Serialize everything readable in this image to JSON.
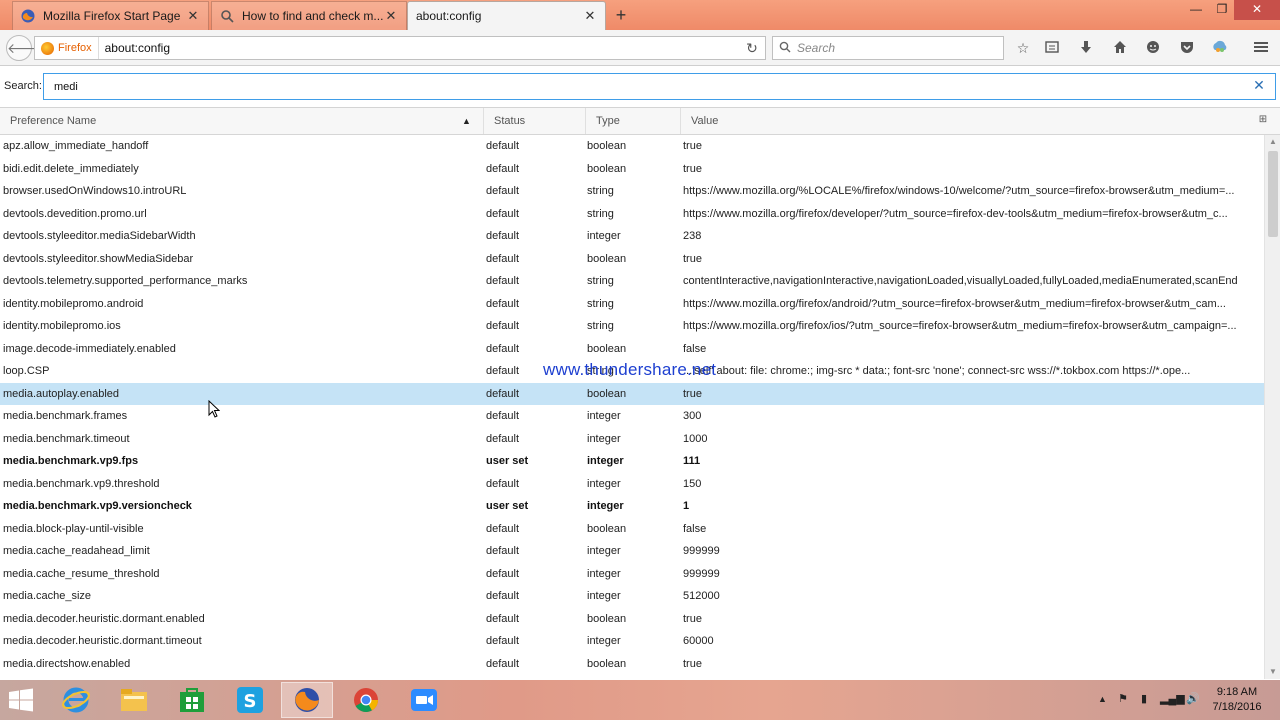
{
  "tabs": [
    {
      "label": "Mozilla Firefox Start Page",
      "close": "✕"
    },
    {
      "label": "How to find and check m...",
      "close": "✕"
    },
    {
      "label": "about:config",
      "close": "✕"
    }
  ],
  "new_tab_label": "+",
  "window_controls": {
    "minimize": "—",
    "restore": "❐",
    "close": "✕"
  },
  "navbar": {
    "identity_label": "Firefox",
    "url": "about:config",
    "search_placeholder": "Search"
  },
  "filter": {
    "label": "Search:",
    "value": "medi"
  },
  "columns": {
    "name": "Preference Name",
    "status": "Status",
    "type": "Type",
    "value": "Value"
  },
  "prefs": [
    {
      "name": "apz.allow_immediate_handoff",
      "status": "default",
      "type": "boolean",
      "value": "true"
    },
    {
      "name": "bidi.edit.delete_immediately",
      "status": "default",
      "type": "boolean",
      "value": "true"
    },
    {
      "name": "browser.usedOnWindows10.introURL",
      "status": "default",
      "type": "string",
      "value": "https://www.mozilla.org/%LOCALE%/firefox/windows-10/welcome/?utm_source=firefox-browser&utm_medium=..."
    },
    {
      "name": "devtools.devedition.promo.url",
      "status": "default",
      "type": "string",
      "value": "https://www.mozilla.org/firefox/developer/?utm_source=firefox-dev-tools&utm_medium=firefox-browser&utm_c..."
    },
    {
      "name": "devtools.styleeditor.mediaSidebarWidth",
      "status": "default",
      "type": "integer",
      "value": "238"
    },
    {
      "name": "devtools.styleeditor.showMediaSidebar",
      "status": "default",
      "type": "boolean",
      "value": "true"
    },
    {
      "name": "devtools.telemetry.supported_performance_marks",
      "status": "default",
      "type": "string",
      "value": "contentInteractive,navigationInteractive,navigationLoaded,visuallyLoaded,fullyLoaded,mediaEnumerated,scanEnd"
    },
    {
      "name": "identity.mobilepromo.android",
      "status": "default",
      "type": "string",
      "value": "https://www.mozilla.org/firefox/android/?utm_source=firefox-browser&utm_medium=firefox-browser&utm_cam..."
    },
    {
      "name": "identity.mobilepromo.ios",
      "status": "default",
      "type": "string",
      "value": "https://www.mozilla.org/firefox/ios/?utm_source=firefox-browser&utm_medium=firefox-browser&utm_campaign=..."
    },
    {
      "name": "image.decode-immediately.enabled",
      "status": "default",
      "type": "boolean",
      "value": "false"
    },
    {
      "name": "loop.CSP",
      "status": "default",
      "type": "string",
      "value": "...'self' about: file: chrome:; img-src * data:; font-src 'none'; connect-src wss://*.tokbox.com https://*.ope..."
    },
    {
      "name": "media.autoplay.enabled",
      "status": "default",
      "type": "boolean",
      "value": "true",
      "selected": true
    },
    {
      "name": "media.benchmark.frames",
      "status": "default",
      "type": "integer",
      "value": "300"
    },
    {
      "name": "media.benchmark.timeout",
      "status": "default",
      "type": "integer",
      "value": "1000"
    },
    {
      "name": "media.benchmark.vp9.fps",
      "status": "user set",
      "type": "integer",
      "value": "111"
    },
    {
      "name": "media.benchmark.vp9.threshold",
      "status": "default",
      "type": "integer",
      "value": "150"
    },
    {
      "name": "media.benchmark.vp9.versioncheck",
      "status": "user set",
      "type": "integer",
      "value": "1"
    },
    {
      "name": "media.block-play-until-visible",
      "status": "default",
      "type": "boolean",
      "value": "false"
    },
    {
      "name": "media.cache_readahead_limit",
      "status": "default",
      "type": "integer",
      "value": "999999"
    },
    {
      "name": "media.cache_resume_threshold",
      "status": "default",
      "type": "integer",
      "value": "999999"
    },
    {
      "name": "media.cache_size",
      "status": "default",
      "type": "integer",
      "value": "512000"
    },
    {
      "name": "media.decoder.heuristic.dormant.enabled",
      "status": "default",
      "type": "boolean",
      "value": "true"
    },
    {
      "name": "media.decoder.heuristic.dormant.timeout",
      "status": "default",
      "type": "integer",
      "value": "60000"
    },
    {
      "name": "media.directshow.enabled",
      "status": "default",
      "type": "boolean",
      "value": "true"
    }
  ],
  "watermark": "www.thundershare.net",
  "toolbar_icons": [
    "bookmark-star-icon",
    "reading-list-icon",
    "download-icon",
    "home-icon",
    "hello-icon",
    "pocket-icon",
    "sync-icon",
    "menu-icon"
  ],
  "taskbar_apps": [
    "internet-explorer-icon",
    "file-explorer-icon",
    "store-icon",
    "skype-icon",
    "firefox-icon",
    "chrome-icon",
    "zoom-icon"
  ],
  "clock": {
    "time": "9:18 AM",
    "date": "7/18/2016"
  },
  "colors": {
    "accent": "#3f9de8",
    "selection": "#c5e3f6",
    "titlebar": "#ef8a68",
    "watermark": "#1d3fd0"
  }
}
